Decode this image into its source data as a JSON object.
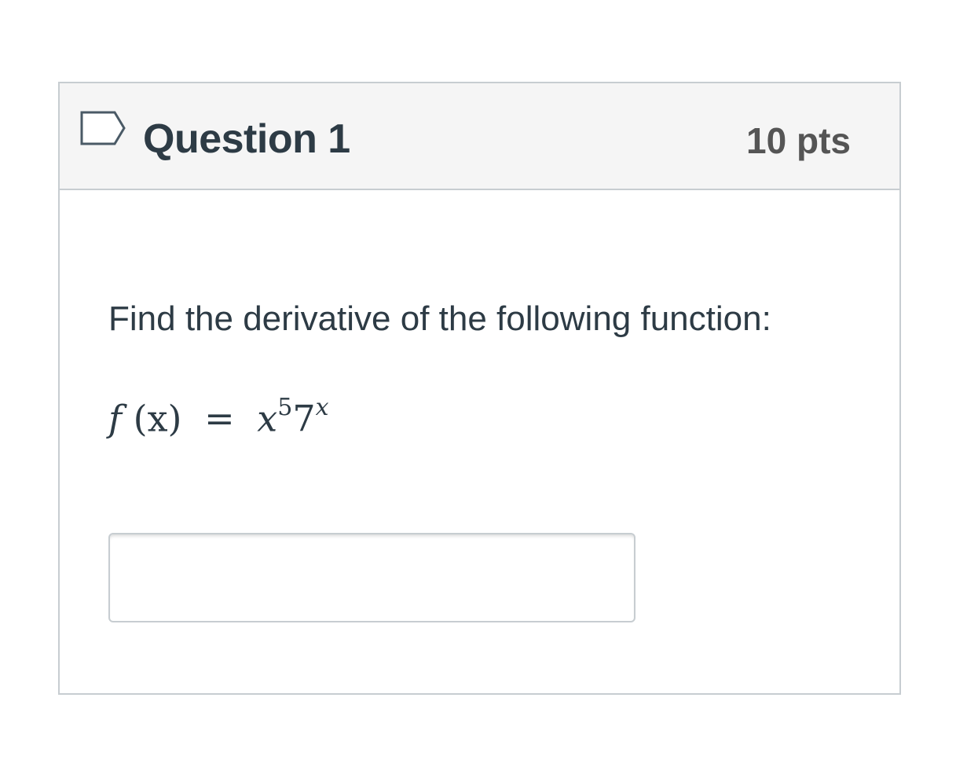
{
  "question": {
    "title": "Question 1",
    "points": "10 pts",
    "flag_icon": "flag-icon",
    "prompt": "Find the derivative of the following function:",
    "formula": {
      "lhs_f": "f",
      "lhs_arg": "(x)",
      "equals": "=",
      "base1": "x",
      "exp1": "5",
      "base2": "7",
      "exp2": "x"
    },
    "answer": {
      "value": "",
      "placeholder": ""
    }
  },
  "colors": {
    "header_bg": "#f5f5f5",
    "border": "#c7cdd1",
    "text": "#2d3b45",
    "points_text": "#555555"
  }
}
